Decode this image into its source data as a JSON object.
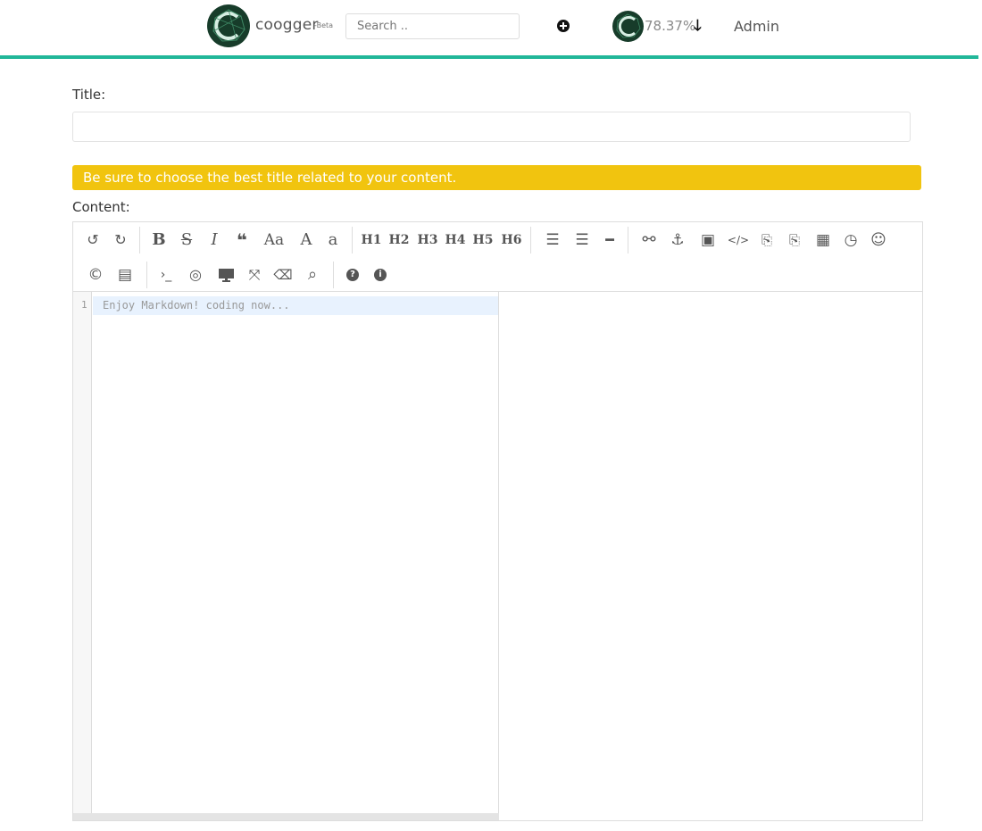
{
  "header": {
    "brand": "coogger",
    "beta": "-Beta",
    "search_placeholder": "Search ..",
    "voting_power": "78.37%",
    "admin": "Admin"
  },
  "form": {
    "title_label": "Title:",
    "title_value": "",
    "alert": "Be sure to choose the best title related to your content.",
    "content_label": "Content:"
  },
  "editor": {
    "line_number": "1",
    "placeholder": "Enjoy Markdown! coding now...",
    "toolbar": {
      "undo": "↺",
      "redo": "↻",
      "bold": "B",
      "strike": "S",
      "italic": "I",
      "quote": "❝",
      "uppercase": "Aa",
      "ucwords": "A",
      "lowercase": "a",
      "h1": "H1",
      "h2": "H2",
      "h3": "H3",
      "h4": "H4",
      "h5": "H5",
      "h6": "H6",
      "list_ul": "☰",
      "list_ol": "☰",
      "hr": "━",
      "link": "⚯",
      "anchor": "⚓",
      "image": "▣",
      "code": "</>",
      "code_block": "⎘",
      "pre": "⎘",
      "table": "▦",
      "datetime": "◷",
      "emoji": "☺",
      "html_entities": "©",
      "pagebreak": "▤",
      "watch": "›_",
      "preview": "◎",
      "fullscreen": "⤧",
      "clear": "⌫",
      "search": "⌕",
      "help": "?",
      "info": "i"
    }
  },
  "colors": {
    "accent": "#21b799",
    "alert_bg": "#f1c40f",
    "logo_bg": "#173c2a"
  },
  "icons": {
    "add": "plus-circle-icon",
    "down": "arrow-down-icon"
  }
}
